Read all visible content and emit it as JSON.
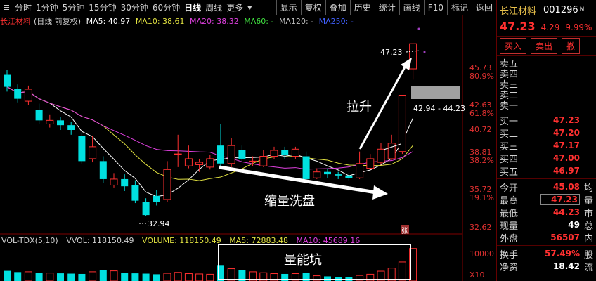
{
  "toolbar": {
    "tabs": [
      "分时",
      "1分钟",
      "5分钟",
      "15分钟",
      "30分钟",
      "60分钟",
      "日线",
      "周线",
      "更多"
    ],
    "active_tab": "日线",
    "right_buttons": [
      "显示",
      "复权",
      "叠加",
      "历史",
      "统计",
      "画线",
      "F10",
      "标记",
      "返回"
    ]
  },
  "legend": {
    "stock": "长江材料",
    "mode": "(日线 前复权)",
    "ma5": "MA5: 40.97",
    "ma10": "MA10: 38.61",
    "ma20": "MA20: 38.32",
    "ma60": "MA60: -",
    "ma120": "MA120: -",
    "ma250": "MA250: -"
  },
  "colors": {
    "up": "#ff3030",
    "down": "#00e0e0",
    "ma5": "#ffffff",
    "ma10": "#e0e040",
    "ma20": "#e040e0",
    "ma60": "#40e040",
    "ma120": "#c0c0c0",
    "ma250": "#4060ff"
  },
  "price_scale": {
    "labels": [
      "45.73",
      "42.63",
      "40.72",
      "38.81",
      "35.72",
      "32.62"
    ],
    "percents": [
      "80.9%",
      "61.8%",
      "38.2%",
      "19.1%"
    ]
  },
  "annotations": {
    "high_tag": "47.23",
    "low_tag": "32.94",
    "range_tag": "42.94 - 44.23",
    "rise_label": "拉升",
    "wash_label": "缩量洗盘",
    "volume_pit_label": "量能坑",
    "zhang_mark": "张"
  },
  "volume_legend": {
    "name": "VOL-TDX(5,10)",
    "vvol": "VVOL: 118150.49",
    "volume": "VOLUME: 118150.49",
    "ma5": "MA5: 72883.48",
    "ma10": "MA10: 45689.16",
    "scale_top": "10000",
    "scale_unit": "X10"
  },
  "panel": {
    "name": "长江材料",
    "code": "001296",
    "flag": "N",
    "price": "47.23",
    "change": "4.29",
    "pct": "9.99%",
    "buy": "买入",
    "sell": "卖出",
    "cancel": "撤",
    "sells": [
      "卖五",
      "卖四",
      "卖三",
      "卖二",
      "卖一"
    ],
    "buys": [
      {
        "label": "买一",
        "value": "47.23"
      },
      {
        "label": "买二",
        "value": "47.20"
      },
      {
        "label": "买三",
        "value": "47.17"
      },
      {
        "label": "买四",
        "value": "47.00"
      },
      {
        "label": "买五",
        "value": "46.97"
      }
    ],
    "stats": [
      {
        "label": "今开",
        "value": "45.08",
        "extra": "均"
      },
      {
        "label": "最高",
        "value": "47.23",
        "extra": "量"
      },
      {
        "label": "最低",
        "value": "44.23",
        "extra": "市"
      },
      {
        "label": "现量",
        "value": "49",
        "extra": "总"
      },
      {
        "label": "外盘",
        "value": "56507",
        "extra": "内"
      }
    ],
    "bottom": [
      {
        "label": "换手",
        "value": "57.49%",
        "extra": "股"
      },
      {
        "label": "净资",
        "value": "18.42",
        "extra": "流"
      }
    ]
  },
  "chart_data": {
    "type": "candlestick",
    "y_range": [
      31.5,
      48.5
    ],
    "candles": [
      {
        "o": 44.6,
        "c": 43.6,
        "h": 45.0,
        "l": 43.2
      },
      {
        "o": 43.4,
        "c": 42.6,
        "h": 43.8,
        "l": 42.3
      },
      {
        "o": 42.4,
        "c": 43.4,
        "h": 43.7,
        "l": 42.1
      },
      {
        "o": 41.7,
        "c": 40.8,
        "h": 42.2,
        "l": 40.5
      },
      {
        "o": 40.5,
        "c": 40.8,
        "h": 41.3,
        "l": 40.2
      },
      {
        "o": 40.8,
        "c": 40.4,
        "h": 41.1,
        "l": 40.0
      },
      {
        "o": 40.4,
        "c": 40.0,
        "h": 40.7,
        "l": 39.6
      },
      {
        "o": 39.5,
        "c": 37.4,
        "h": 39.8,
        "l": 37.2
      },
      {
        "o": 37.6,
        "c": 38.6,
        "h": 39.5,
        "l": 37.3
      },
      {
        "o": 37.4,
        "c": 35.9,
        "h": 37.8,
        "l": 35.6
      },
      {
        "o": 35.4,
        "c": 35.9,
        "h": 36.4,
        "l": 35.2
      },
      {
        "o": 35.9,
        "c": 35.3,
        "h": 36.3,
        "l": 34.9
      },
      {
        "o": 35.4,
        "c": 34.1,
        "h": 35.8,
        "l": 33.9
      },
      {
        "o": 34.0,
        "c": 32.9,
        "h": 34.3,
        "l": 32.8
      },
      {
        "o": 34.5,
        "c": 34.0,
        "h": 35.0,
        "l": 33.7
      },
      {
        "o": 34.2,
        "c": 36.7,
        "h": 37.4,
        "l": 34.0
      },
      {
        "o": 38.0,
        "c": 38.0,
        "h": 39.6,
        "l": 36.9
      },
      {
        "o": 37.0,
        "c": 37.6,
        "h": 38.7,
        "l": 36.8
      },
      {
        "o": 37.1,
        "c": 37.3,
        "h": 37.6,
        "l": 36.5
      },
      {
        "o": 36.9,
        "c": 37.6,
        "h": 37.9,
        "l": 36.7
      },
      {
        "o": 38.7,
        "c": 37.2,
        "h": 40.5,
        "l": 37.0
      },
      {
        "o": 37.2,
        "c": 38.7,
        "h": 39.3,
        "l": 36.9
      },
      {
        "o": 38.3,
        "c": 37.6,
        "h": 38.7,
        "l": 37.4
      },
      {
        "o": 37.4,
        "c": 37.4,
        "h": 37.8,
        "l": 37.0
      },
      {
        "o": 37.0,
        "c": 37.8,
        "h": 38.3,
        "l": 36.9
      },
      {
        "o": 37.8,
        "c": 38.3,
        "h": 38.6,
        "l": 37.6
      },
      {
        "o": 38.3,
        "c": 37.9,
        "h": 38.6,
        "l": 37.6
      },
      {
        "o": 37.8,
        "c": 38.4,
        "h": 38.6,
        "l": 37.6
      },
      {
        "o": 37.8,
        "c": 35.9,
        "h": 38.2,
        "l": 35.7
      },
      {
        "o": 36.0,
        "c": 36.5,
        "h": 36.8,
        "l": 35.9
      },
      {
        "o": 36.5,
        "c": 36.3,
        "h": 36.8,
        "l": 36.0
      },
      {
        "o": 36.3,
        "c": 36.2,
        "h": 36.5,
        "l": 35.9
      },
      {
        "o": 36.2,
        "c": 36.0,
        "h": 36.4,
        "l": 35.8
      },
      {
        "o": 36.0,
        "c": 37.2,
        "h": 38.2,
        "l": 35.9
      },
      {
        "o": 36.8,
        "c": 37.6,
        "h": 38.0,
        "l": 36.7
      },
      {
        "o": 37.3,
        "c": 38.4,
        "h": 38.9,
        "l": 37.1
      },
      {
        "o": 37.6,
        "c": 38.9,
        "h": 39.6,
        "l": 37.5
      },
      {
        "o": 38.2,
        "c": 42.9,
        "h": 42.9,
        "l": 38.0
      },
      {
        "o": 45.1,
        "c": 47.2,
        "h": 47.2,
        "l": 44.2
      }
    ],
    "volumes": [
      330,
      290,
      300,
      270,
      260,
      250,
      240,
      230,
      300,
      350,
      330,
      260,
      250,
      240,
      220,
      250,
      280,
      240,
      230,
      220,
      520,
      400,
      360,
      300,
      270,
      240,
      230,
      240,
      260,
      170,
      150,
      130,
      130,
      180,
      220,
      320,
      420,
      620,
      1060
    ]
  }
}
